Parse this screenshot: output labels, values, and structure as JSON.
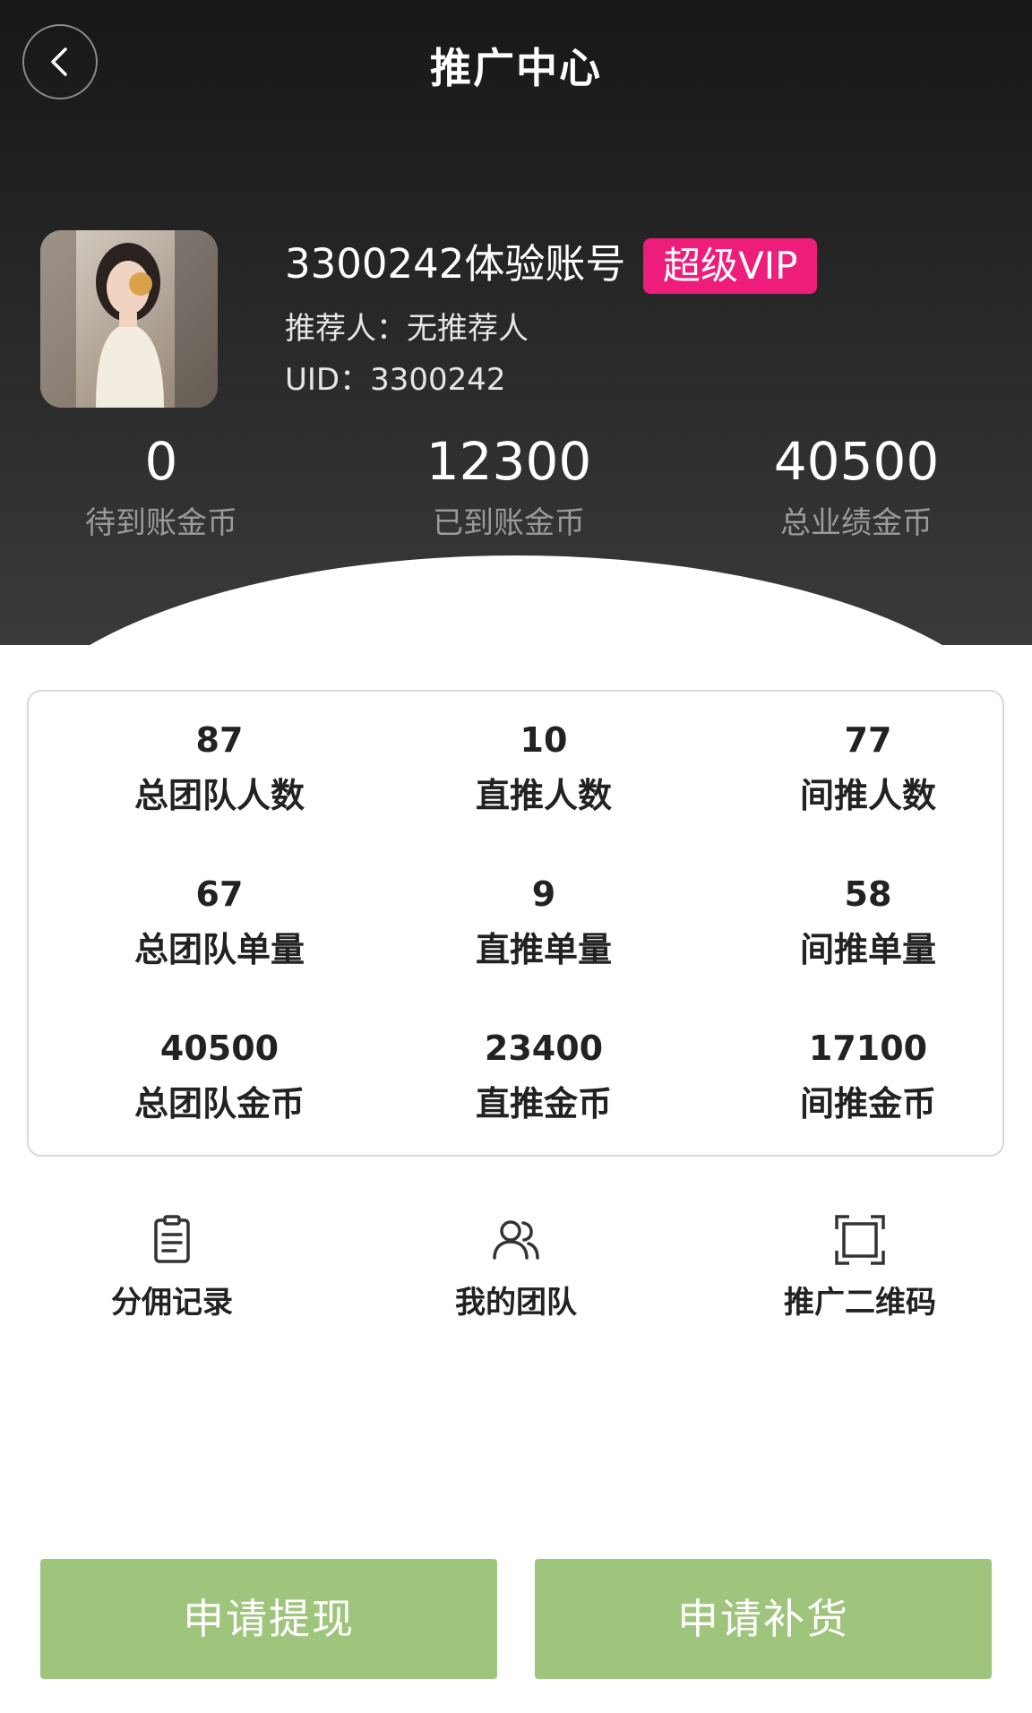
{
  "header": {
    "title": "推广中心"
  },
  "profile": {
    "username": "3300242体验账号",
    "vip_badge": "超级VIP",
    "referrer": "推荐人：无推荐人",
    "uid": "UID：3300242"
  },
  "coins": [
    {
      "value": "0",
      "label": "待到账金币"
    },
    {
      "value": "12300",
      "label": "已到账金币"
    },
    {
      "value": "40500",
      "label": "总业绩金币"
    }
  ],
  "stats": [
    {
      "value": "87",
      "label": "总团队人数"
    },
    {
      "value": "10",
      "label": "直推人数"
    },
    {
      "value": "77",
      "label": "间推人数"
    },
    {
      "value": "67",
      "label": "总团队单量"
    },
    {
      "value": "9",
      "label": "直推单量"
    },
    {
      "value": "58",
      "label": "间推单量"
    },
    {
      "value": "40500",
      "label": "总团队金币"
    },
    {
      "value": "23400",
      "label": "直推金币"
    },
    {
      "value": "17100",
      "label": "间推金币"
    }
  ],
  "actions": [
    {
      "label": "分佣记录",
      "icon": "clipboard-icon"
    },
    {
      "label": "我的团队",
      "icon": "team-icon"
    },
    {
      "label": "推广二维码",
      "icon": "qr-frame-icon"
    }
  ],
  "buttons": {
    "withdraw": "申请提现",
    "restock": "申请补货"
  },
  "colors": {
    "header_bg": "#1f1f1f",
    "vip_badge": "#ee1c7b",
    "button_green": "#9fc57d",
    "card_border": "#d9d9d9"
  }
}
